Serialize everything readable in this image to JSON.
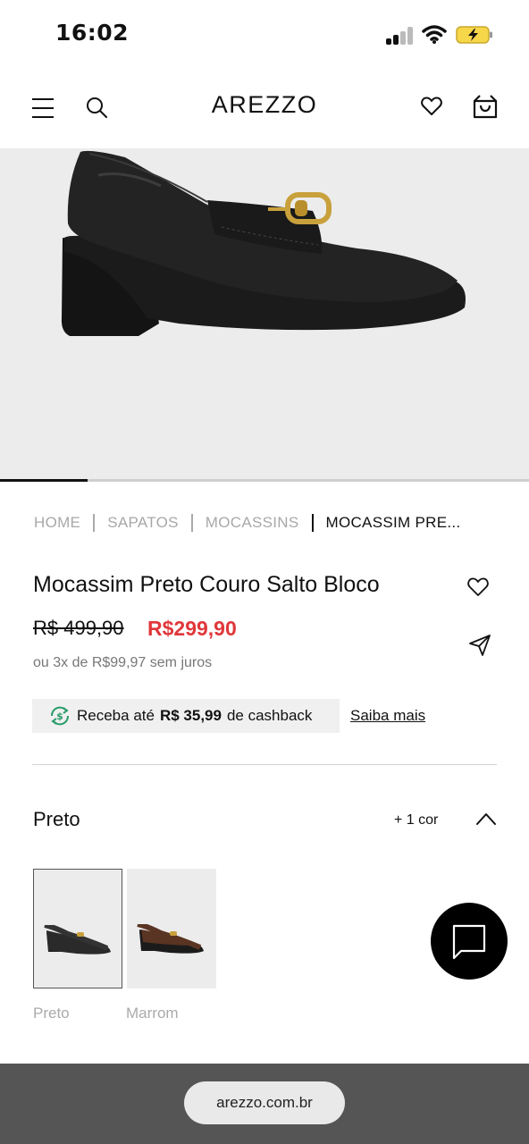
{
  "status_bar": {
    "time": "16:02"
  },
  "header": {
    "brand": "AREZZO"
  },
  "breadcrumb": [
    "HOME",
    "SAPATOS",
    "MOCASSINS",
    "MOCASSIM PRE..."
  ],
  "product": {
    "title": "Mocassim Preto Couro Salto Bloco",
    "old_price": "R$ 499,90",
    "price": "R$299,90",
    "installments": "ou 3x de R$99,97 sem juros",
    "price_color": "#e0373a"
  },
  "cashback": {
    "prefix": "Receba até",
    "amount": "R$ 35,99",
    "suffix": "de cashback",
    "link": "Saiba mais",
    "icon_color": "#2a9d6a"
  },
  "colors": {
    "selected": "Preto",
    "more": "+ 1 cor",
    "options": [
      {
        "name": "Preto",
        "color": "#1a1a1a"
      },
      {
        "name": "Marrom",
        "color": "#5a3422"
      }
    ]
  },
  "browser": {
    "url": "arezzo.com.br"
  },
  "icons": [
    "menu-icon",
    "search-icon",
    "heart-icon",
    "bag-icon",
    "share-icon",
    "cashback-icon",
    "chevron-up-icon",
    "chat-icon"
  ]
}
